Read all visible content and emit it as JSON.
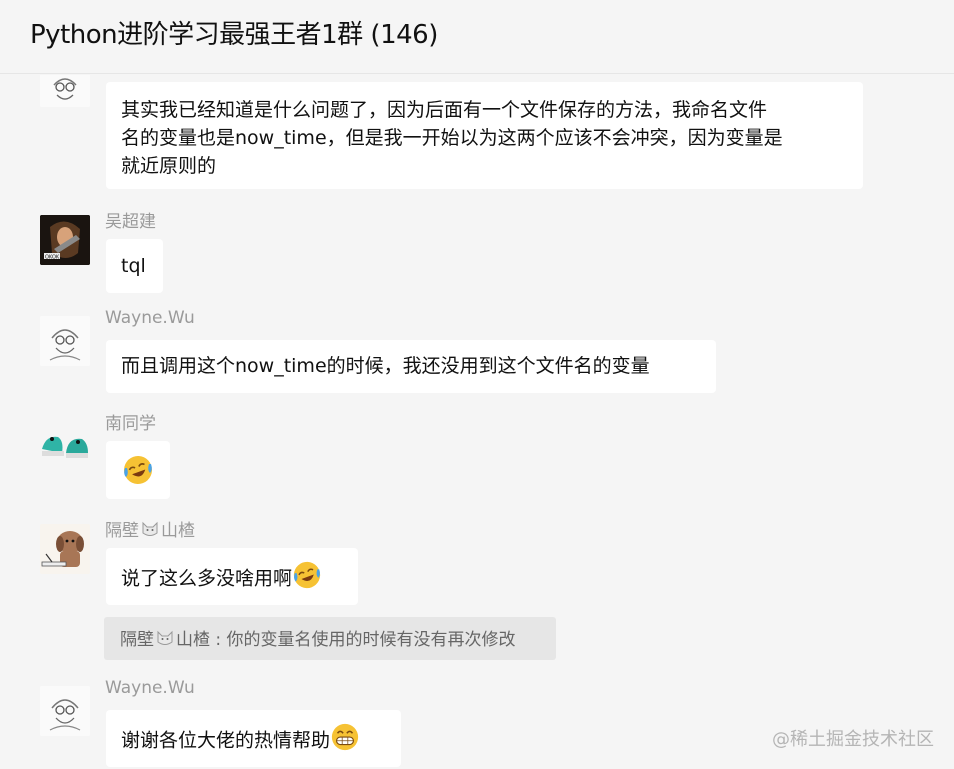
{
  "chat": {
    "title": "Python进阶学习最强王者1群 (146)"
  },
  "messages": [
    {
      "text": "其实我已经知道是什么问题了，因为后面有一个文件保存的方法，我命名文件\n名的变量也是now_time，但是我一开始以为这两个应该不会冲突，因为变量是\n就近原则的"
    },
    {
      "sender": "吴超建",
      "text": "tql"
    },
    {
      "sender": "Wayne.Wu",
      "text": "而且调用这个now_time的时候，我还没用到这个文件名的变量"
    },
    {
      "sender": "南同学",
      "emoji": "crying-laughing-emoji"
    },
    {
      "sender_a": "隔壁",
      "sender_b": "山楂",
      "text": "说了这么多没啥用啊",
      "quote_a": "隔壁",
      "quote_b": "山楂 : 你的变量名使用的时候有没有再次修改"
    },
    {
      "sender": "Wayne.Wu",
      "text": "谢谢各位大佬的热情帮助"
    }
  ],
  "watermark": "@稀土掘金技术社区"
}
